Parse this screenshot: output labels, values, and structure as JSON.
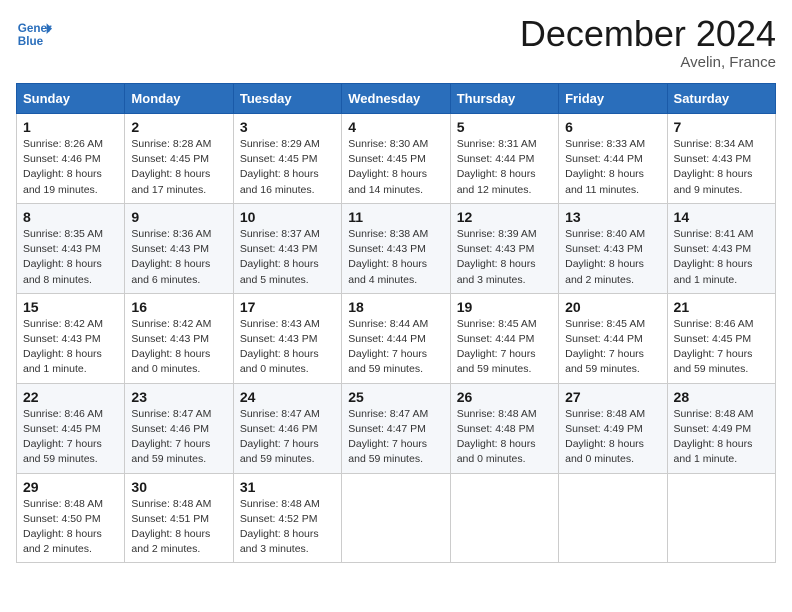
{
  "header": {
    "logo_line1": "General",
    "logo_line2": "Blue",
    "month": "December 2024",
    "location": "Avelin, France"
  },
  "days_of_week": [
    "Sunday",
    "Monday",
    "Tuesday",
    "Wednesday",
    "Thursday",
    "Friday",
    "Saturday"
  ],
  "weeks": [
    [
      {
        "day": 1,
        "sunrise": "8:26 AM",
        "sunset": "4:46 PM",
        "daylight": "8 hours and 19 minutes."
      },
      {
        "day": 2,
        "sunrise": "8:28 AM",
        "sunset": "4:45 PM",
        "daylight": "8 hours and 17 minutes."
      },
      {
        "day": 3,
        "sunrise": "8:29 AM",
        "sunset": "4:45 PM",
        "daylight": "8 hours and 16 minutes."
      },
      {
        "day": 4,
        "sunrise": "8:30 AM",
        "sunset": "4:45 PM",
        "daylight": "8 hours and 14 minutes."
      },
      {
        "day": 5,
        "sunrise": "8:31 AM",
        "sunset": "4:44 PM",
        "daylight": "8 hours and 12 minutes."
      },
      {
        "day": 6,
        "sunrise": "8:33 AM",
        "sunset": "4:44 PM",
        "daylight": "8 hours and 11 minutes."
      },
      {
        "day": 7,
        "sunrise": "8:34 AM",
        "sunset": "4:43 PM",
        "daylight": "8 hours and 9 minutes."
      }
    ],
    [
      {
        "day": 8,
        "sunrise": "8:35 AM",
        "sunset": "4:43 PM",
        "daylight": "8 hours and 8 minutes."
      },
      {
        "day": 9,
        "sunrise": "8:36 AM",
        "sunset": "4:43 PM",
        "daylight": "8 hours and 6 minutes."
      },
      {
        "day": 10,
        "sunrise": "8:37 AM",
        "sunset": "4:43 PM",
        "daylight": "8 hours and 5 minutes."
      },
      {
        "day": 11,
        "sunrise": "8:38 AM",
        "sunset": "4:43 PM",
        "daylight": "8 hours and 4 minutes."
      },
      {
        "day": 12,
        "sunrise": "8:39 AM",
        "sunset": "4:43 PM",
        "daylight": "8 hours and 3 minutes."
      },
      {
        "day": 13,
        "sunrise": "8:40 AM",
        "sunset": "4:43 PM",
        "daylight": "8 hours and 2 minutes."
      },
      {
        "day": 14,
        "sunrise": "8:41 AM",
        "sunset": "4:43 PM",
        "daylight": "8 hours and 1 minute."
      }
    ],
    [
      {
        "day": 15,
        "sunrise": "8:42 AM",
        "sunset": "4:43 PM",
        "daylight": "8 hours and 1 minute."
      },
      {
        "day": 16,
        "sunrise": "8:42 AM",
        "sunset": "4:43 PM",
        "daylight": "8 hours and 0 minutes."
      },
      {
        "day": 17,
        "sunrise": "8:43 AM",
        "sunset": "4:43 PM",
        "daylight": "8 hours and 0 minutes."
      },
      {
        "day": 18,
        "sunrise": "8:44 AM",
        "sunset": "4:44 PM",
        "daylight": "7 hours and 59 minutes."
      },
      {
        "day": 19,
        "sunrise": "8:45 AM",
        "sunset": "4:44 PM",
        "daylight": "7 hours and 59 minutes."
      },
      {
        "day": 20,
        "sunrise": "8:45 AM",
        "sunset": "4:44 PM",
        "daylight": "7 hours and 59 minutes."
      },
      {
        "day": 21,
        "sunrise": "8:46 AM",
        "sunset": "4:45 PM",
        "daylight": "7 hours and 59 minutes."
      }
    ],
    [
      {
        "day": 22,
        "sunrise": "8:46 AM",
        "sunset": "4:45 PM",
        "daylight": "7 hours and 59 minutes."
      },
      {
        "day": 23,
        "sunrise": "8:47 AM",
        "sunset": "4:46 PM",
        "daylight": "7 hours and 59 minutes."
      },
      {
        "day": 24,
        "sunrise": "8:47 AM",
        "sunset": "4:46 PM",
        "daylight": "7 hours and 59 minutes."
      },
      {
        "day": 25,
        "sunrise": "8:47 AM",
        "sunset": "4:47 PM",
        "daylight": "7 hours and 59 minutes."
      },
      {
        "day": 26,
        "sunrise": "8:48 AM",
        "sunset": "4:48 PM",
        "daylight": "8 hours and 0 minutes."
      },
      {
        "day": 27,
        "sunrise": "8:48 AM",
        "sunset": "4:49 PM",
        "daylight": "8 hours and 0 minutes."
      },
      {
        "day": 28,
        "sunrise": "8:48 AM",
        "sunset": "4:49 PM",
        "daylight": "8 hours and 1 minute."
      }
    ],
    [
      {
        "day": 29,
        "sunrise": "8:48 AM",
        "sunset": "4:50 PM",
        "daylight": "8 hours and 2 minutes."
      },
      {
        "day": 30,
        "sunrise": "8:48 AM",
        "sunset": "4:51 PM",
        "daylight": "8 hours and 2 minutes."
      },
      {
        "day": 31,
        "sunrise": "8:48 AM",
        "sunset": "4:52 PM",
        "daylight": "8 hours and 3 minutes."
      },
      null,
      null,
      null,
      null
    ]
  ]
}
